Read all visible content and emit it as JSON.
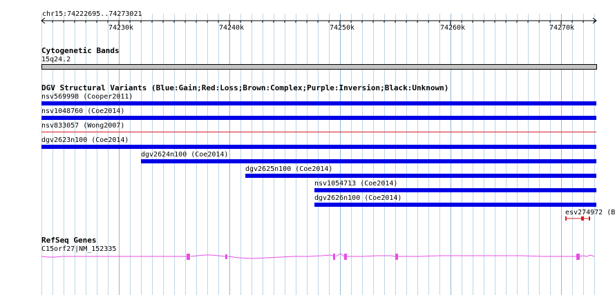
{
  "ruler": {
    "location": "chr15:74222695..74273021",
    "ticks": [
      "74230k",
      "74240k",
      "74250k",
      "74260k",
      "74270k"
    ]
  },
  "cytoband_track": {
    "title": "Cytogenetic Bands",
    "band_label": "15q24.2",
    "band_color": "#c4c4c4"
  },
  "dgv_track": {
    "title": "DGV Structural Variants (Blue:Gain;Red:Loss;Brown:Complex;Purple:Inversion;Black:Unknown)",
    "gain_color": "#0000e6",
    "loss_color": "#d71920",
    "features": [
      {
        "label": "nsv569998 (Cooper2011)",
        "type": "gain"
      },
      {
        "label": "nsv1048760 (Coe2014)",
        "type": "gain"
      },
      {
        "label": "nsv833057 (Wong2007)",
        "type": "loss"
      },
      {
        "label": "dgv2623n100 (Coe2014)",
        "type": "gain"
      },
      {
        "label": "dgv2624n100 (Coe2014)",
        "type": "gain"
      },
      {
        "label": "dgv2625n100 (Coe2014)",
        "type": "gain"
      },
      {
        "label": "nsv1054713 (Coe2014)",
        "type": "gain"
      },
      {
        "label": "dgv2626n100 (Coe2014)",
        "type": "gain"
      },
      {
        "label": "esv274972 (B",
        "type": "loss"
      }
    ]
  },
  "refseq_track": {
    "title": "RefSeq Genes",
    "gene_label": "C15orf27|NM_152335",
    "gene_color": "#e64ee6"
  }
}
